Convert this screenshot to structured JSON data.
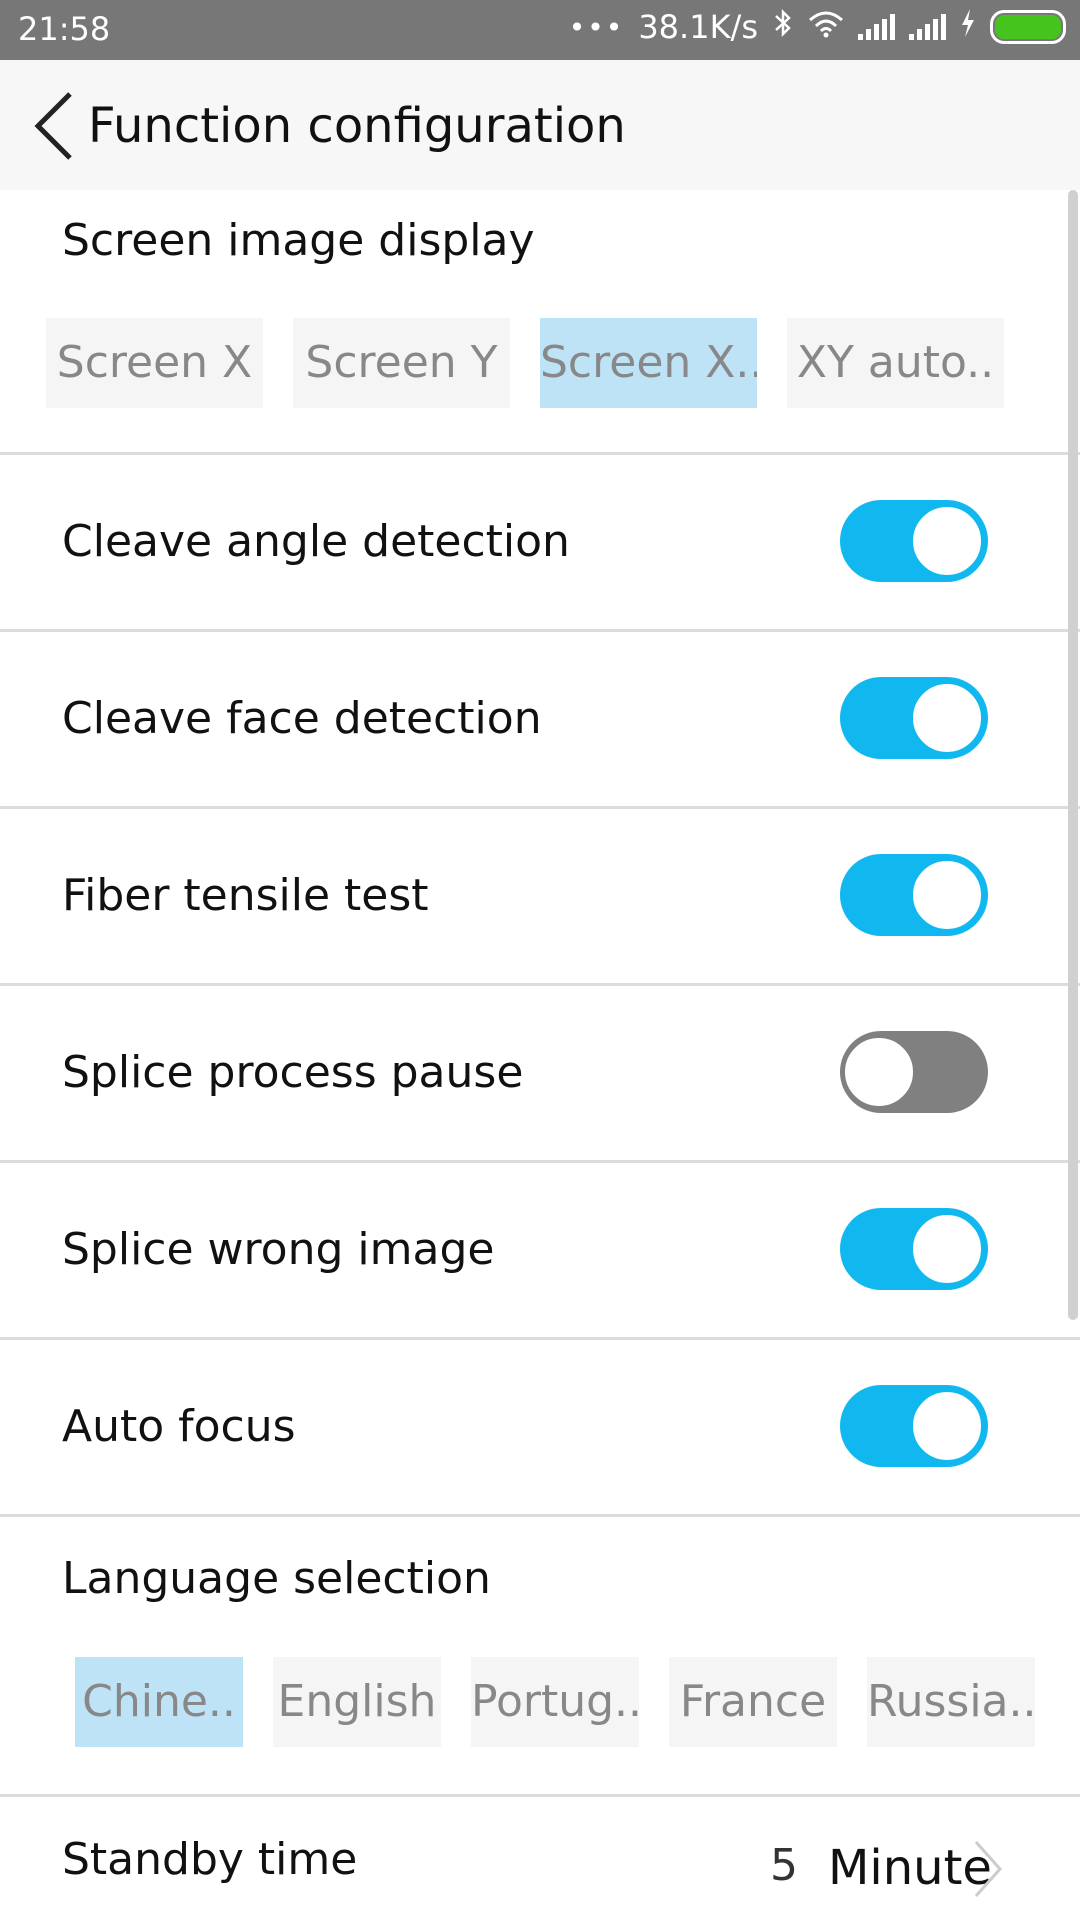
{
  "status_bar": {
    "time": "21:58",
    "network_speed": "38.1K/s",
    "icons": [
      "more-dots-icon",
      "bluetooth-icon",
      "wifi-icon",
      "signal-icon",
      "signal-icon",
      "charging-icon",
      "battery-icon"
    ],
    "battery_color": "#46c41e"
  },
  "header": {
    "title": "Function configuration",
    "back_icon": "chevron-left-icon"
  },
  "screen_image_display": {
    "label": "Screen image display",
    "options": [
      {
        "label": "Screen X",
        "selected": false
      },
      {
        "label": "Screen Y",
        "selected": false
      },
      {
        "label": "Screen X..",
        "selected": true
      },
      {
        "label": "XY auto..",
        "selected": false
      }
    ]
  },
  "toggles": [
    {
      "label": "Cleave angle detection",
      "on": true
    },
    {
      "label": "Cleave face detection",
      "on": true
    },
    {
      "label": "Fiber tensile test",
      "on": true
    },
    {
      "label": "Splice process pause",
      "on": false
    },
    {
      "label": "Splice wrong image",
      "on": true
    },
    {
      "label": "Auto focus",
      "on": true
    }
  ],
  "language_selection": {
    "label": "Language selection",
    "options": [
      {
        "label": "Chine..",
        "selected": true
      },
      {
        "label": "English",
        "selected": false
      },
      {
        "label": "Portug..",
        "selected": false
      },
      {
        "label": "France",
        "selected": false
      },
      {
        "label": "Russia..",
        "selected": false
      }
    ]
  },
  "standby": {
    "label": "Standby time",
    "value": "5",
    "unit": "Minute"
  },
  "colors": {
    "accent": "#11b8ef",
    "selected_chip": "#bee3f6",
    "toggle_off": "#808080"
  }
}
